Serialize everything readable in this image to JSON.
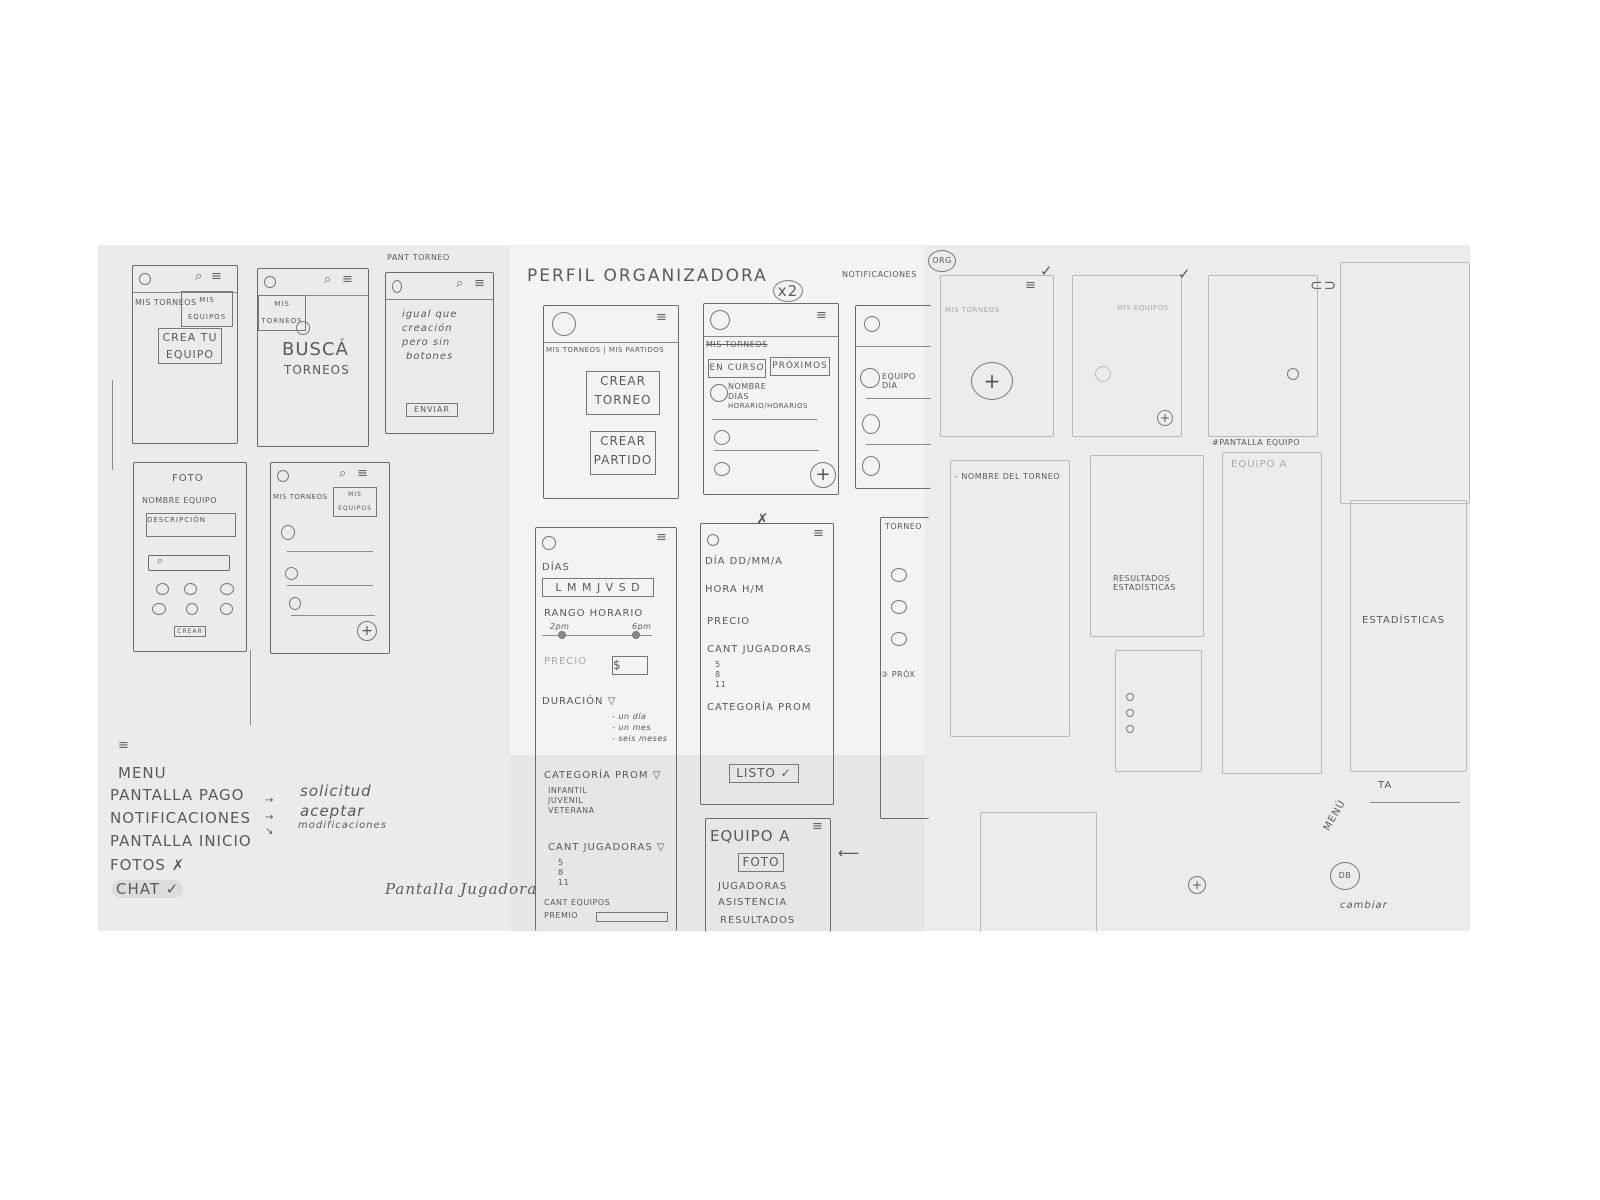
{
  "panel1": {
    "screen_a": {
      "tab1": "MIS TORNEOS",
      "tab2": "MIS EQUIPOS",
      "cta": "CREA TU EQUIPO"
    },
    "screen_b": {
      "tab1": "MIS TORNEOS",
      "headline": "BUSCÁ",
      "headline2": "TORNEOS"
    },
    "screen_c": {
      "label": "PANT TORNEO",
      "note": [
        "igual que",
        "creación",
        "pero sin",
        "botones"
      ],
      "button": "ENVIAR"
    },
    "screen_d": {
      "photo": "FOTO",
      "name": "NOMBRE EQUIPO",
      "description": "DESCRIPCIÓN",
      "button": "CREAR"
    },
    "screen_e": {
      "tab1": "MIS TORNEOS",
      "tab2": "MIS EQUIPOS"
    },
    "notes": {
      "items": [
        "MENU",
        "PANTALLA PAGO",
        "NOTIFICACIONES",
        "PANTALLA INICIO",
        "FOTOS ✗",
        "CHAT ✓"
      ],
      "sub_items": [
        "solicitud",
        "aceptar",
        "modificaciones"
      ],
      "signature": "Pantalla Jugadora"
    }
  },
  "panel2": {
    "title": "PERFIL ORGANIZADORA",
    "badge": "x2",
    "screen_f": {
      "tabs": "MIS TORNEOS | MIS PARTIDOS",
      "btn1": "CREAR TORNEO",
      "btn2": "CREAR PARTIDO"
    },
    "screen_g": {
      "struck_tab": "MIS TORNEOS",
      "tab1": "EN CURSO",
      "tab2": "PRÓXIMOS",
      "item": [
        "NOMBRE",
        "DÍAS",
        "HORARIO/HORARIOS"
      ]
    },
    "notifications": {
      "label": "NOTIFICACIONES",
      "item": "EQUIPO DÍA"
    },
    "form_tournament": {
      "days_label": "DÍAS",
      "days": "L M M J V S D",
      "range_label": "RANGO HORARIO",
      "range_from": "2pm",
      "range_to": "6pm",
      "price_label": "PRECIO",
      "price_value": "$",
      "duration_label": "DURACIÓN ▽",
      "duration_options": [
        "- un día",
        "- un mes",
        "- seis meses"
      ],
      "category_label": "CATEGORÍA PROM ▽",
      "category_options": [
        "INFANTIL",
        "JUVENIL",
        "VETERANA"
      ],
      "players_label": "CANT JUGADORAS ▽",
      "players_options": [
        "5",
        "8",
        "11"
      ],
      "teams_label": "CANT EQUIPOS",
      "prize_label": "PREMIO"
    },
    "form_match": {
      "date": "DÍA DD/MM/A",
      "time": "HORA H/M",
      "price": "PRECIO",
      "players": "CANT JUGADORAS",
      "players_options": [
        "5",
        "8",
        "11"
      ],
      "category": "CATEGORÍA PROM",
      "done": "LISTO ✓"
    },
    "team": {
      "title": "EQUIPO A",
      "photo": "FOTO",
      "rows": [
        "JUGADORAS",
        "ASISTENCIA",
        "RESULTADOS"
      ]
    },
    "side": {
      "header": "TORNEO",
      "next": "③ PRÓX"
    }
  },
  "panel3": {
    "badge": "ORG",
    "tournament_name": "- NOMBRE DEL TORNEO",
    "team_screen_label": "#PANTALLA EQUIPO",
    "team_title": "EQUIPO A",
    "results": "RESULTADOS ESTADÍSTICAS",
    "stats": "ESTADÍSTICAS",
    "menu": "MENÚ",
    "avatar": "DB",
    "ta": "TA",
    "change": "cambiar",
    "tab_a": "MIS TORNEOS",
    "tab_b": "MIS EQUIPOS"
  }
}
